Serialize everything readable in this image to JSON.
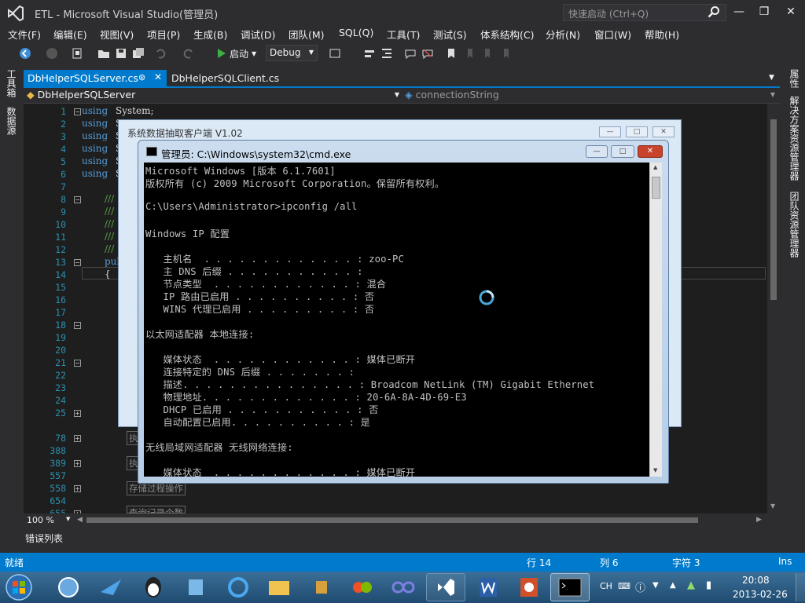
{
  "window": {
    "title": "ETL - Microsoft Visual Studio(管理员)",
    "quick_launch_placeholder": "快速启动 (Ctrl+Q)"
  },
  "menu": [
    "文件(F)",
    "编辑(E)",
    "视图(V)",
    "项目(P)",
    "生成(B)",
    "调试(D)",
    "团队(M)",
    "SQL(Q)",
    "工具(T)",
    "测试(S)",
    "体系结构(C)",
    "分析(N)",
    "窗口(W)",
    "帮助(H)"
  ],
  "toolbar": {
    "start_label": "启动",
    "config_value": "Debug"
  },
  "left_sidebar": {
    "toolbox": "工具箱",
    "datasource": "数据源"
  },
  "right_sidebar": {
    "properties": "属性",
    "solution_explorer": "解决方案资源管理器",
    "team_explorer": "团队资源管理器"
  },
  "tabs": [
    {
      "label": "DbHelperSQLServer.cs",
      "active": true
    },
    {
      "label": "DbHelperSQLClient.cs",
      "active": false
    }
  ],
  "navbar": {
    "class_label": "DbHelperSQLServer",
    "member_label": "connectionString"
  },
  "editor": {
    "line_numbers": [
      "1",
      "2",
      "3",
      "4",
      "5",
      "6",
      "7",
      "8",
      "9",
      "10",
      "11",
      "12",
      "13",
      "14",
      "15",
      "16",
      "17",
      "18",
      "19",
      "20",
      "21",
      "22",
      "23",
      "24",
      "25",
      "78",
      "388",
      "389",
      "557",
      "558",
      "654",
      "655"
    ],
    "using_kw": "using",
    "using_system": "System;",
    "using_s": "S",
    "comment": "///",
    "pub": "pub",
    "brace": "{",
    "region_zhi": "执",
    "region_sp": "存储过程操作",
    "region_count": "查询记录个数"
  },
  "zoom": "100 %",
  "error_list": "错误列表",
  "status": {
    "ready": "就绪",
    "line": "行 14",
    "col": "列 6",
    "char": "字符 3",
    "mode": "Ins"
  },
  "taskbar": {
    "clock_time": "20:08",
    "clock_date": "2013-02-26",
    "ime": "CH"
  },
  "bg_dialog": {
    "title": "系统数据抽取客户端 V1.02"
  },
  "cmd": {
    "title": "管理员: C:\\Windows\\system32\\cmd.exe",
    "lines": [
      "Microsoft Windows [版本 6.1.7601]",
      "版权所有 (c) 2009 Microsoft Corporation。保留所有权利。",
      "",
      "C:\\Users\\Administrator>ipconfig /all",
      "",
      "Windows IP 配置",
      "",
      "   主机名  . . . . . . . . . . . . . : zoo-PC",
      "   主 DNS 后缀 . . . . . . . . . . . :",
      "   节点类型  . . . . . . . . . . . . : 混合",
      "   IP 路由已启用 . . . . . . . . . . : 否",
      "   WINS 代理已启用 . . . . . . . . . : 否",
      "",
      "以太网适配器 本地连接:",
      "",
      "   媒体状态  . . . . . . . . . . . . : 媒体已断开",
      "   连接特定的 DNS 后缀 . . . . . . . :",
      "   描述. . . . . . . . . . . . . . . : Broadcom NetLink (TM) Gigabit Ethernet",
      "   物理地址. . . . . . . . . . . . . : 20-6A-8A-4D-69-E3",
      "   DHCP 已启用 . . . . . . . . . . . : 否",
      "   自动配置已启用. . . . . . . . . . : 是",
      "",
      "无线局域网适配器 无线网络连接:",
      "",
      "   媒体状态  . . . . . . . . . . . . : 媒体已断开"
    ]
  }
}
